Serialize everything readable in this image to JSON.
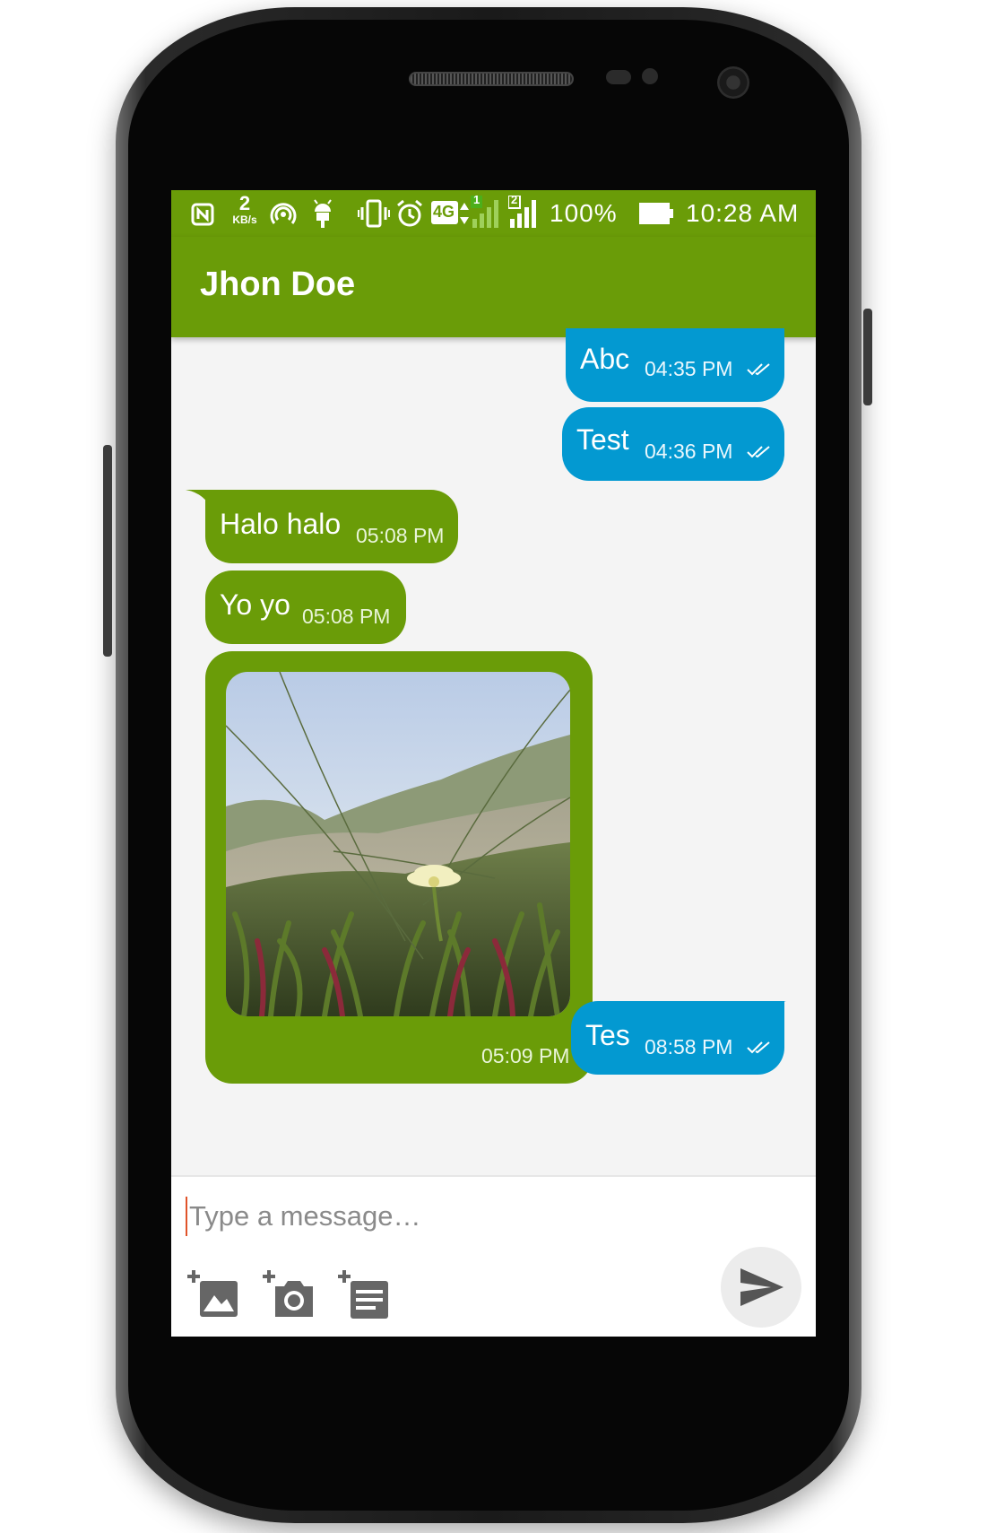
{
  "status_bar": {
    "speed_value": "2",
    "speed_unit": "KB/s",
    "sim1_label": "1",
    "sim2_label": "2",
    "network": "4G",
    "battery_percent": "100%",
    "time": "10:28 AM",
    "icons": [
      "nfc-icon",
      "data-speed-icon",
      "hotspot-icon",
      "android-debug-icon",
      "vibrate-icon",
      "alarm-icon",
      "network-4g-icon",
      "signal-sim1-icon",
      "signal-sim2-icon",
      "battery-icon"
    ]
  },
  "app_bar": {
    "title": "Jhon Doe"
  },
  "messages": [
    {
      "direction": "out",
      "text": "Abc",
      "time": "04:35 PM",
      "status": "delivered"
    },
    {
      "direction": "out",
      "text": "Test",
      "time": "04:36 PM",
      "status": "delivered"
    },
    {
      "direction": "in",
      "text": "Halo halo",
      "time": "05:08 PM"
    },
    {
      "direction": "in",
      "text": "Yo yo",
      "time": "05:08 PM"
    },
    {
      "direction": "in",
      "type": "image",
      "image": "flower-in-grass-photo",
      "time": "05:09 PM"
    },
    {
      "direction": "out",
      "text": "Tes",
      "time": "08:58 PM",
      "status": "delivered"
    }
  ],
  "composer": {
    "placeholder": "Type a message…",
    "value": "",
    "tools": [
      "add-image-icon",
      "add-camera-icon",
      "add-document-icon"
    ],
    "send_icon": "send-icon"
  },
  "colors": {
    "primary": "#6a9c08",
    "outgoing_bubble": "#0399d1",
    "incoming_bubble": "#6a9c08",
    "chat_background": "#f4f4f4"
  }
}
